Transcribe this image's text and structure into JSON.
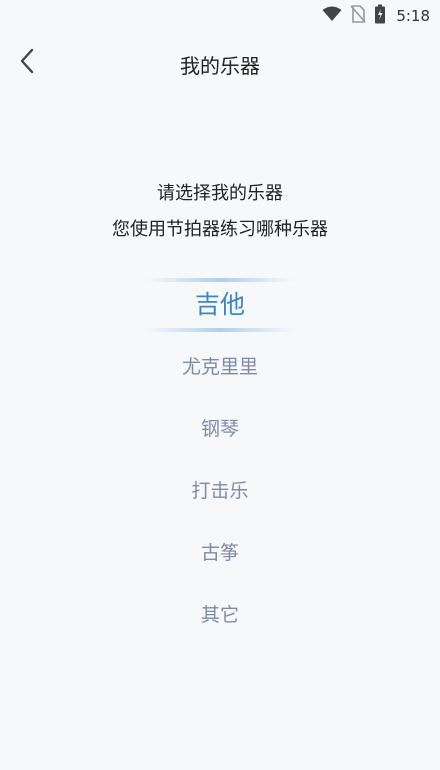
{
  "status_bar": {
    "time": "5:18",
    "icons": [
      "wifi-icon",
      "no-sim-icon",
      "battery-icon"
    ]
  },
  "nav": {
    "back_icon": "chevron-left-icon",
    "title": "我的乐器"
  },
  "prompt": {
    "line1": "请选择我的乐器",
    "line2": "您使用节拍器练习哪种乐器"
  },
  "instruments": {
    "selected_index": 0,
    "items": [
      {
        "label": "吉他"
      },
      {
        "label": "尤克里里"
      },
      {
        "label": "钢琴"
      },
      {
        "label": "打击乐"
      },
      {
        "label": "古筝"
      },
      {
        "label": "其它"
      }
    ]
  },
  "colors": {
    "background": "#f7f8fa",
    "selected": "#3a86c8",
    "unselected": "#7e8aa6"
  }
}
